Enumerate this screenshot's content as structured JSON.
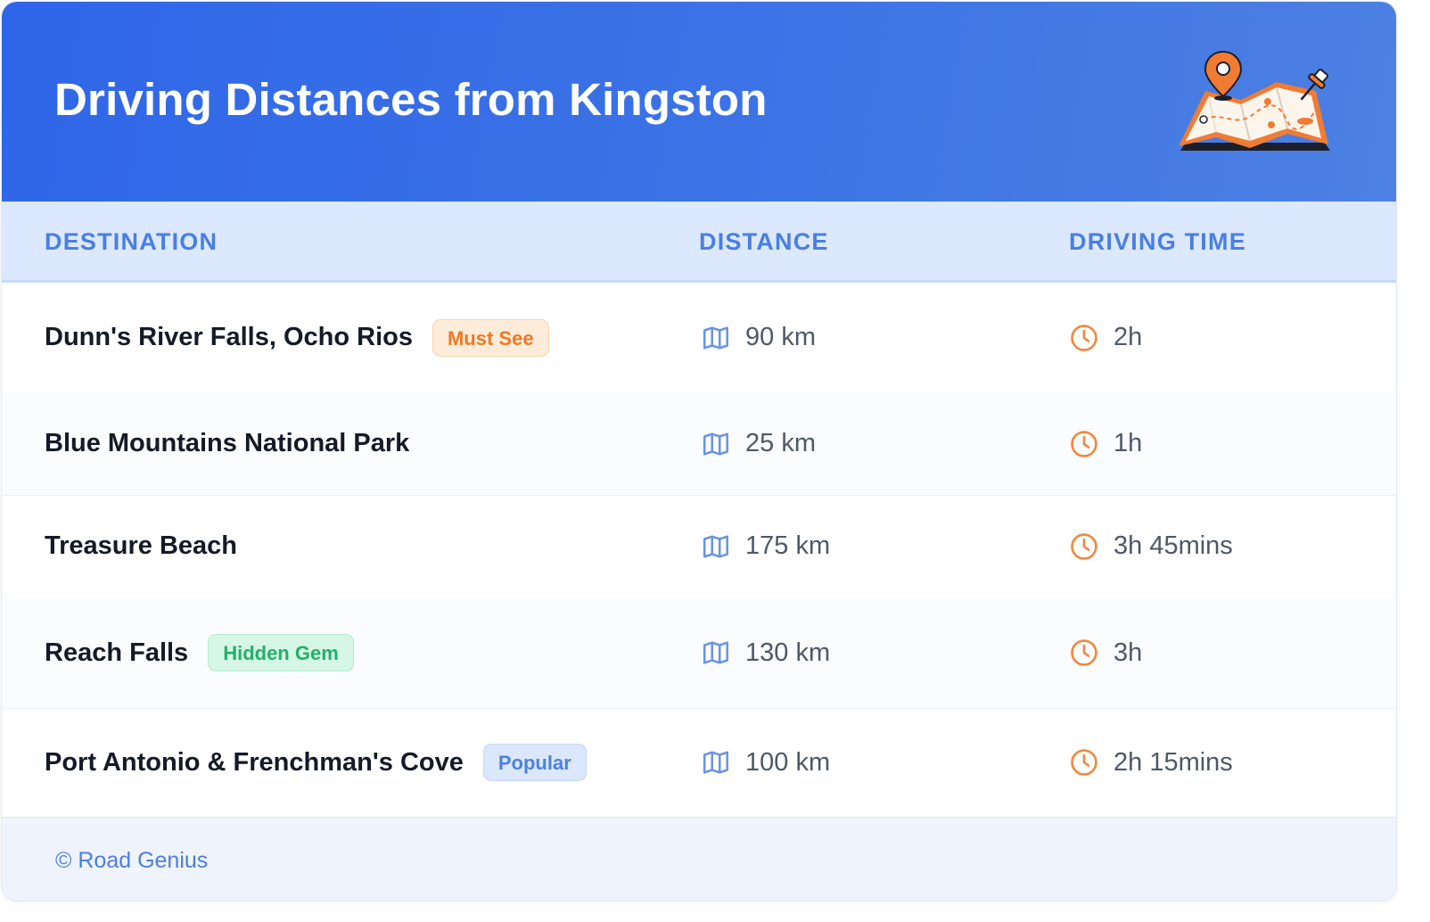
{
  "header": {
    "title": "Driving Distances from Kingston",
    "illustration_icon": "folded-map-with-pin-icon"
  },
  "columns": {
    "destination": "DESTINATION",
    "distance": "DISTANCE",
    "time": "DRIVING TIME"
  },
  "rows": [
    {
      "destination": "Dunn's River Falls, Ocho Rios",
      "badge": "Must See",
      "distance": "90 km",
      "time": "2h"
    },
    {
      "destination": "Blue Mountains National Park",
      "badge": "",
      "distance": "25 km",
      "time": "1h"
    },
    {
      "destination": "Treasure Beach",
      "badge": "",
      "distance": "175 km",
      "time": "3h 45mins"
    },
    {
      "destination": "Reach Falls",
      "badge": "Hidden Gem",
      "distance": "130 km",
      "time": "3h"
    },
    {
      "destination": "Port Antonio & Frenchman's Cove",
      "badge": "Popular",
      "distance": "100 km",
      "time": "2h 15mins"
    }
  ],
  "icons": {
    "distance": "map-icon",
    "time": "clock-icon"
  },
  "footer": {
    "credit": "© Road Genius"
  },
  "colors": {
    "header_start": "#2f66e8",
    "header_end": "#4d80e2",
    "accent_blue": "#4a7fe0",
    "badge_orange": "#ed7a24",
    "badge_green": "#22b06a",
    "badge_blue": "#4c82e0",
    "clock_orange": "#ee8a45",
    "map_icon_blue": "#6c95de"
  }
}
